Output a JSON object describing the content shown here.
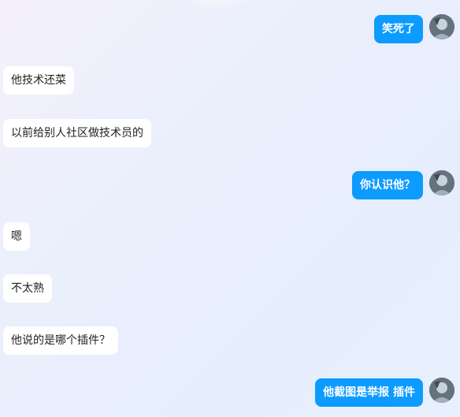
{
  "messages": [
    {
      "side": "right",
      "text": "笑死了"
    },
    {
      "side": "left",
      "text": "他技术还菜"
    },
    {
      "side": "left",
      "text": "以前给别人社区做技术员的"
    },
    {
      "side": "right",
      "text": "你认识他？"
    },
    {
      "side": "left",
      "text": "嗯"
    },
    {
      "side": "left",
      "text": "不太熟"
    },
    {
      "side": "left",
      "text": "他说的是哪个插件？"
    },
    {
      "side": "right",
      "text": "他截图是举报 插件"
    }
  ],
  "colors": {
    "outgoing_bubble": "#0d9bff",
    "incoming_bubble": "#ffffff"
  }
}
